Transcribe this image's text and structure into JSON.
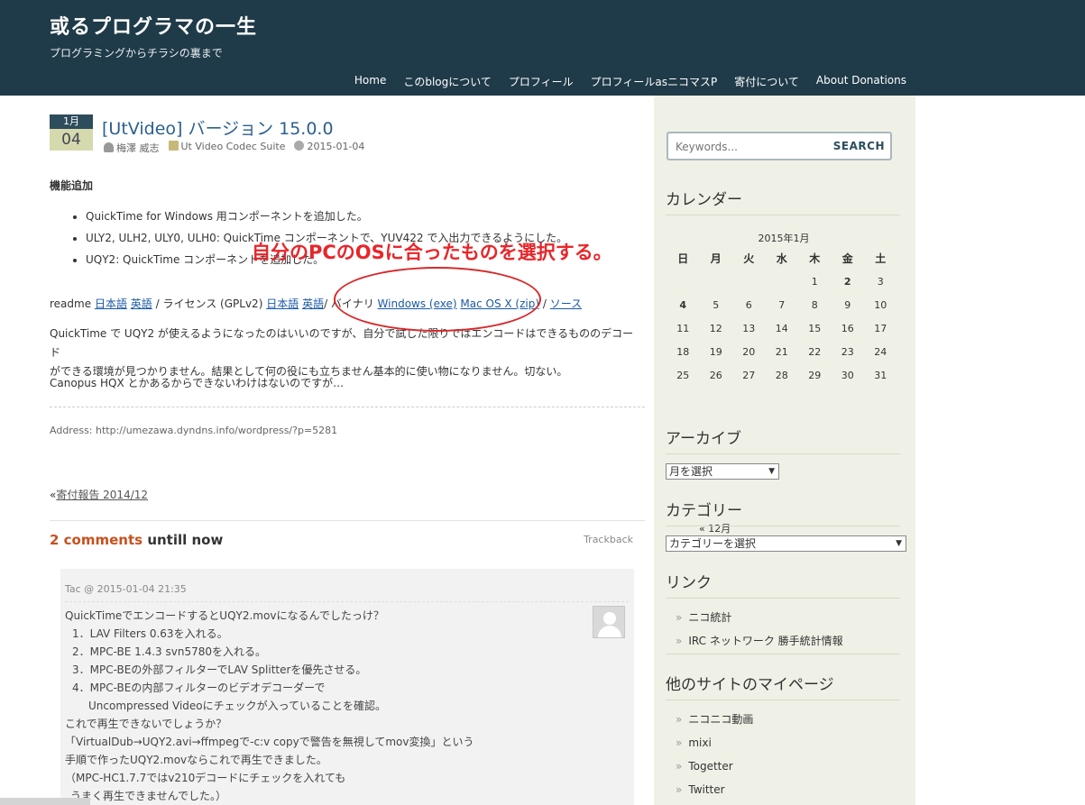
{
  "site": {
    "title": "或るプログラマの一生",
    "description": "プログラミングからチラシの裏まで"
  },
  "nav": [
    "Home",
    "このblogについて",
    "プロフィール",
    "プロフィールasニコマスP",
    "寄付について",
    "About Donations"
  ],
  "post": {
    "month": "1月",
    "day": "04",
    "title": "[UtVideo] バージョン 15.0.0",
    "author": "梅澤 威志",
    "category": "Ut Video Codec Suite",
    "date": "2015-01-04",
    "section_heading": "機能追加",
    "features": [
      "QuickTime for Windows 用コンポーネントを追加した。",
      "ULY2, ULH2, ULY0, ULH0: QuickTime コンポーネントで、YUV422 で入出力できるようにした。",
      "UQY2: QuickTime コンポーネントを追加した。"
    ],
    "links": {
      "readme": "readme",
      "readme_ja": "日本語",
      "readme_en": "英語",
      "license_label": "/ ライセンス (GPLv2)",
      "license_ja": "日本語",
      "license_en": "英語",
      "binary_label": "/ バイナリ",
      "windows": "Windows (exe)",
      "mac": "Mac OS X (zip)",
      "sep": "/",
      "source": "ソース"
    },
    "paragraph1_line1": "QuickTime で UQY2 が使えるようになったのはいいのですが、自分で試した限りではエンコードはできるもののデコード",
    "paragraph1_line2": "ができる環境が見つかりません。結果として何の役にも立ちません基本的に使い物になりません。切ない。",
    "paragraph2": "Canopus HQX とかあるからできないわけはないのですが…",
    "address": "Address: http://umezawa.dyndns.info/wordpress/?p=5281",
    "prev_link": "寄付報告 2014/12"
  },
  "annotation": {
    "text": "自分のPCのOSに合ったものを選択する。",
    "color": "#e8262a"
  },
  "comments": {
    "count": "2 comments",
    "suffix": "untill now",
    "trackback": "Trackback",
    "first": {
      "meta": "Tac @ 2015-01-04 21:35",
      "lines": [
        "QuickTimeでエンコードするとUQY2.movになるんでしたっけ？",
        "1．LAV Filters 0.63を入れる。",
        "2．MPC-BE 1.4.3 svn5780を入れる。",
        "3．MPC-BEの外部フィルターでLAV Splitterを優先させる。",
        "4．MPC-BEの内部フィルターのビデオデコーダーで",
        "Uncompressed Videoにチェックが入っていることを確認。",
        "これで再生できないでしょうか？",
        "「VirtualDub→UQY2.avi→ffmpegで-c:v copyで警告を無視してmov変換」という",
        "手順で作ったUQY2.movならこれで再生できました。",
        "（MPC-HC1.7.7ではv210デコードにチェックを入れても",
        "うまく再生できませんでした。）"
      ]
    }
  },
  "sidebar": {
    "search_placeholder": "Keywords...",
    "search_button": "SEARCH",
    "calendar_title": "カレンダー",
    "calendar_caption": "2015年1月",
    "weekdays": [
      "日",
      "月",
      "火",
      "水",
      "木",
      "金",
      "土"
    ],
    "calendar_prev": "« 12月",
    "archive_title": "アーカイブ",
    "archive_select": "月を選択",
    "category_title": "カテゴリー",
    "category_select": "カテゴリーを選択",
    "links_title": "リンク",
    "links": [
      "ニコ統計",
      "IRC ネットワーク 勝手統計情報"
    ],
    "mypage_title": "他のサイトのマイページ",
    "mypages": [
      "ニコニコ動画",
      "mixi",
      "Togetter",
      "Twitter"
    ]
  },
  "calendar_days": [
    [
      "",
      "",
      "",
      "",
      "1",
      "2",
      "3"
    ],
    [
      "4",
      "5",
      "6",
      "7",
      "8",
      "9",
      "10"
    ],
    [
      "11",
      "12",
      "13",
      "14",
      "15",
      "16",
      "17"
    ],
    [
      "18",
      "19",
      "20",
      "21",
      "22",
      "23",
      "24"
    ],
    [
      "25",
      "26",
      "27",
      "28",
      "29",
      "30",
      "31"
    ]
  ],
  "calendar_linked_days": [
    "2",
    "4"
  ]
}
